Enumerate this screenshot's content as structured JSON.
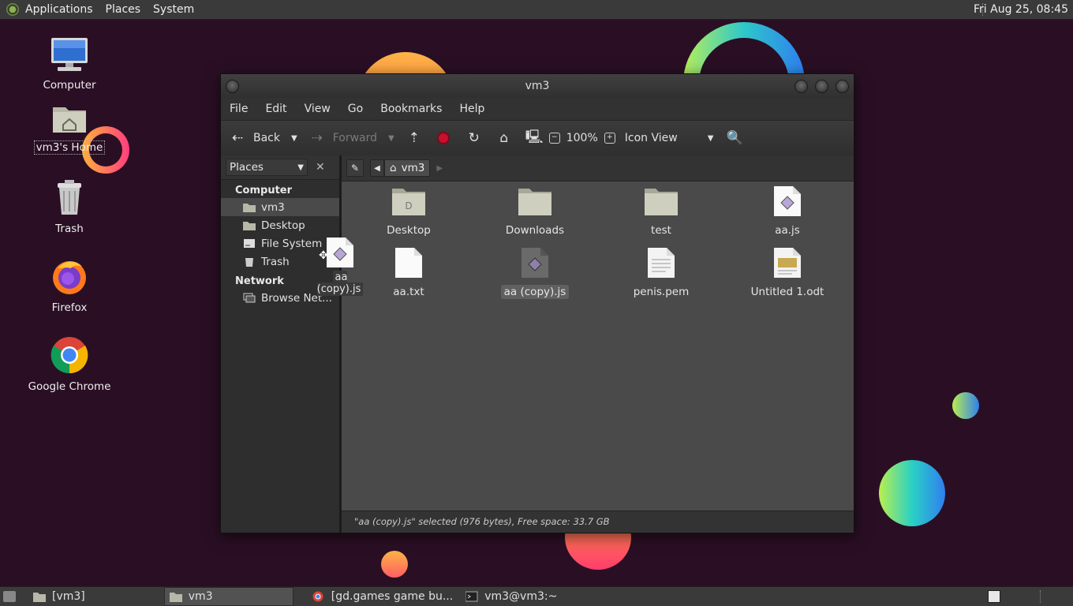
{
  "top_panel": {
    "menus": [
      "Applications",
      "Places",
      "System"
    ],
    "clock": "Fri Aug 25, 08:45"
  },
  "desktop": {
    "icons": [
      {
        "label": "Computer",
        "icon": "computer-icon"
      },
      {
        "label": "vm3's Home",
        "icon": "home-folder-icon"
      },
      {
        "label": "Trash",
        "icon": "trash-icon"
      },
      {
        "label": "Firefox",
        "icon": "firefox-icon"
      },
      {
        "label": "Google Chrome",
        "icon": "chrome-icon"
      }
    ]
  },
  "window": {
    "title": "vm3",
    "menu": [
      "File",
      "Edit",
      "View",
      "Go",
      "Bookmarks",
      "Help"
    ],
    "toolbar": {
      "back": "Back",
      "forward": "Forward",
      "zoom": "100%",
      "view_mode": "Icon View"
    },
    "sidebar": {
      "selector": "Places",
      "sections": [
        {
          "title": "Computer",
          "items": [
            "vm3",
            "Desktop",
            "File System",
            "Trash"
          ]
        },
        {
          "title": "Network",
          "items": [
            "Browse Net..."
          ]
        }
      ]
    },
    "path": {
      "crumb": "vm3"
    },
    "files": [
      {
        "name": "Desktop",
        "type": "folder-desktop"
      },
      {
        "name": "Downloads",
        "type": "folder-downloads"
      },
      {
        "name": "test",
        "type": "folder"
      },
      {
        "name": "aa.js",
        "type": "script"
      },
      {
        "name": "aa.txt",
        "type": "text"
      },
      {
        "name": "aa (copy).js",
        "type": "script",
        "selected": true
      },
      {
        "name": "penis.pem",
        "type": "pem"
      },
      {
        "name": "Untitled 1.odt",
        "type": "odt"
      }
    ],
    "status": "\"aa (copy).js\" selected (976 bytes), Free space: 33.7 GB"
  },
  "drag_ghost": {
    "label": "aa (copy).js"
  },
  "taskbar": {
    "tasks": [
      {
        "label": "[vm3]",
        "active": false
      },
      {
        "label": "vm3",
        "active": true
      },
      {
        "label": "[gd.games game bu...",
        "active": false
      },
      {
        "label": "vm3@vm3:~",
        "active": false
      }
    ]
  },
  "colors": {
    "desktop_bg": "#2a0f24",
    "panel": "#3a3a3a",
    "window_bg": "#2e2e2e",
    "content_bg": "#4a4a4a",
    "stop": "#c8102e"
  }
}
